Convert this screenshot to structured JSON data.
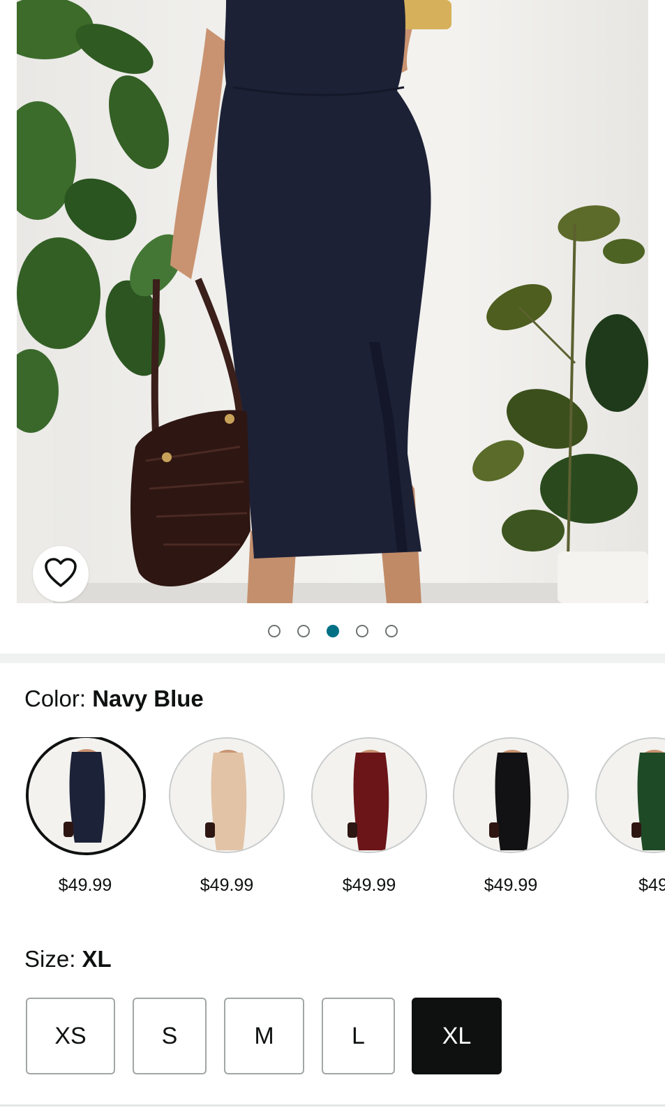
{
  "hero": {
    "wishlist_icon": "heart-outline-icon",
    "carousel": {
      "count": 5,
      "active_index": 2,
      "active_color": "#007185"
    }
  },
  "color": {
    "label": "Color:",
    "selected_name": "Navy Blue",
    "swatches": [
      {
        "color": "#1c2238",
        "price": "$49.99",
        "selected": true
      },
      {
        "color": "#e2c3a6",
        "price": "$49.99",
        "selected": false
      },
      {
        "color": "#6b1518",
        "price": "$49.99",
        "selected": false
      },
      {
        "color": "#121214",
        "price": "$49.99",
        "selected": false
      },
      {
        "color": "#1f4a26",
        "price": "$49",
        "selected": false
      }
    ]
  },
  "size": {
    "label": "Size:",
    "selected_name": "XL",
    "options": [
      {
        "label": "XS",
        "selected": false
      },
      {
        "label": "S",
        "selected": false
      },
      {
        "label": "M",
        "selected": false
      },
      {
        "label": "L",
        "selected": false
      },
      {
        "label": "XL",
        "selected": true
      }
    ]
  }
}
